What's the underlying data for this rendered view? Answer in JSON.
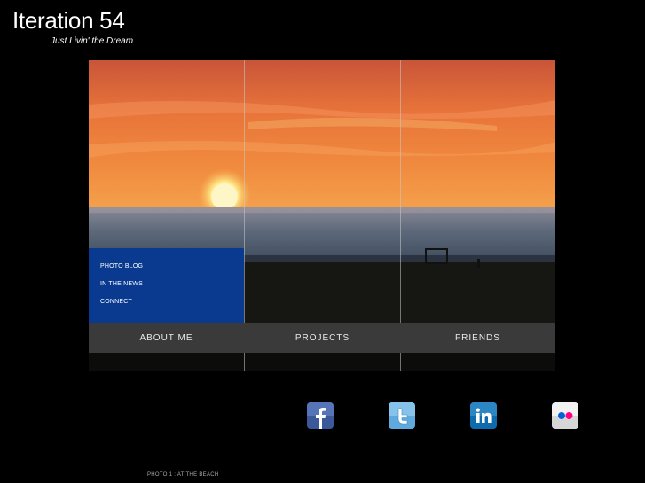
{
  "site": {
    "title": "Iteration 54",
    "tagline": "Just Livin' the Dream"
  },
  "hero": {
    "submenu": [
      "PHOTO BLOG",
      "IN THE NEWS",
      "CONNECT"
    ],
    "menu": [
      "ABOUT ME",
      "PROJECTS",
      "FRIENDS"
    ],
    "submenu_color": "#0a3a8f"
  },
  "social": [
    {
      "name": "facebook",
      "icon": "facebook-icon",
      "glyph": "f",
      "color": "#3b5998"
    },
    {
      "name": "twitter",
      "icon": "twitter-icon",
      "glyph": "t",
      "color": "#5fa9dd"
    },
    {
      "name": "linkedin",
      "icon": "linkedin-icon",
      "glyph": "in",
      "color": "#0e6cae"
    },
    {
      "name": "flickr",
      "icon": "flickr-icon",
      "glyph": "",
      "color": "#f2f2f2"
    }
  ],
  "caption": "PHOTO 1 : AT THE BEACH"
}
